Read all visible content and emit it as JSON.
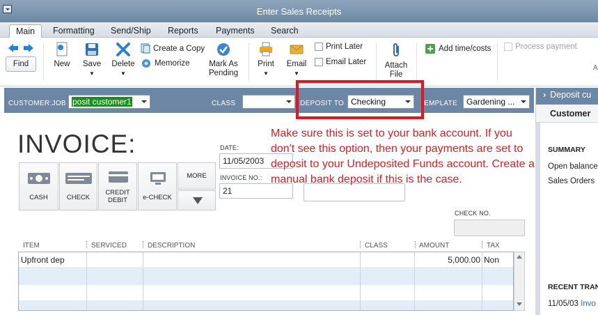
{
  "window": {
    "title": "Enter Sales Receipts"
  },
  "tabs": [
    "Main",
    "Formatting",
    "Send/Ship",
    "Reports",
    "Payments",
    "Search"
  ],
  "ribbon": {
    "find": "Find",
    "new": "New",
    "save": "Save",
    "delete": "Delete",
    "create_copy": "Create a Copy",
    "memorize": "Memorize",
    "mark_as_pending_1": "Mark As",
    "mark_as_pending_2": "Pending",
    "print": "Print",
    "email": "Email",
    "print_later": "Print Later",
    "email_later": "Email Later",
    "attach_file_1": "Attach",
    "attach_file_2": "File",
    "add_time_costs": "Add time/costs",
    "process_payment": "Process payment",
    "overflow": "A"
  },
  "header": {
    "customer_job_label": "CUSTOMER:JOB",
    "customer_job_value": "posit customer1",
    "class_label": "CLASS",
    "class_value": "",
    "deposit_to_label": "DEPOSIT TO",
    "deposit_to_value": "Checking",
    "template_label": "EMPLATE",
    "template_value": "Gardening ..."
  },
  "side_panel": {
    "title": "Deposit cu",
    "tab": "Customer",
    "summary": "SUMMARY",
    "open_balance": "Open balance",
    "sales_orders": "Sales Orders",
    "recent_transactions": "RECENT TRAN",
    "recent_date": "11/05/03",
    "recent_link": "Invo"
  },
  "form": {
    "title": "INVOICE:",
    "payment_buttons": {
      "cash": "CASH",
      "check": "CHECK",
      "credit_1": "CREDIT",
      "credit_2": "DEBIT",
      "echeck": "e-CHECK",
      "more": "MORE"
    },
    "date_label": "DATE:",
    "date_value": "11/05/2003",
    "invoice_no_label": "INVOICE NO.:",
    "invoice_no_value": "21",
    "check_no_label": "CHECK NO."
  },
  "table": {
    "columns": [
      "ITEM",
      "SERVICED",
      "DESCRIPTION",
      "CLASS",
      "AMOUNT",
      "TAX"
    ],
    "rows": [
      {
        "item": "Upfront dep",
        "serviced": "",
        "description": "",
        "class": "",
        "amount": "5,000.00",
        "tax": "Non"
      }
    ]
  },
  "annotation": {
    "text": "Make sure this is set to your bank account. If you don't see this option, then your payments are set to deposit to your Undeposited Funds account. Create a manual bank deposit if this is the case.",
    "color": "#dc1d24"
  }
}
